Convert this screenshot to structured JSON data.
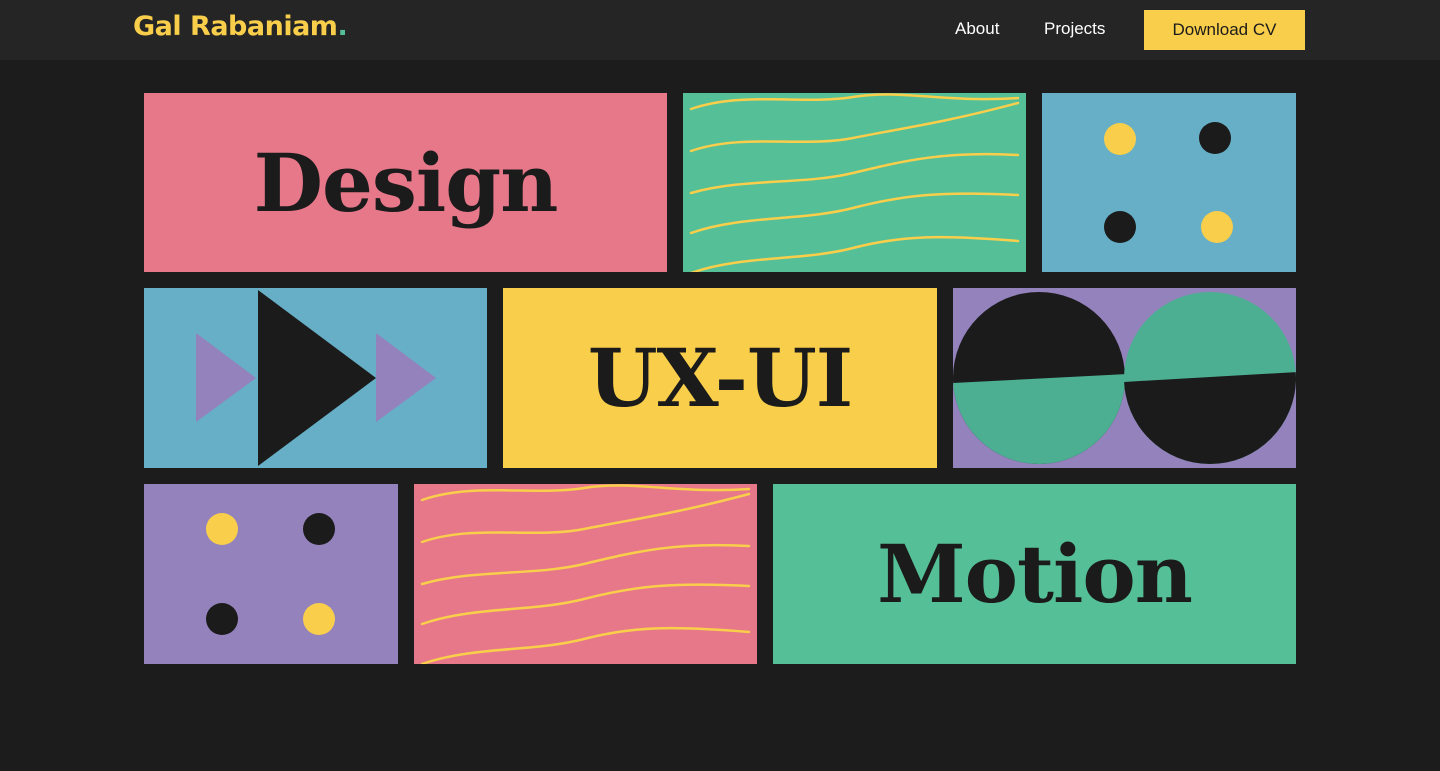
{
  "header": {
    "logo_name": "Gal Rabaniam",
    "logo_dot": ".",
    "nav": {
      "about": "About",
      "projects": "Projects"
    },
    "cv_button": "Download CV"
  },
  "tiles": {
    "design": "Design",
    "uxui": "UX-UI",
    "motion": "Motion"
  },
  "colors": {
    "background": "#1c1c1c",
    "header": "#252525",
    "yellow": "#f9ce4b",
    "pink": "#e6788a",
    "green": "#55c097",
    "blue": "#66afc6",
    "purple": "#9482bd",
    "dark": "#1b1b1b"
  }
}
